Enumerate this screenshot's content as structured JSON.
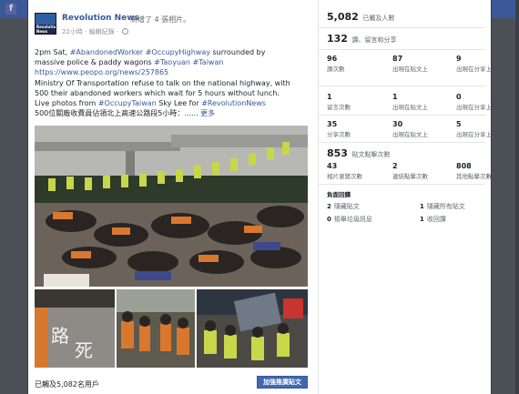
{
  "app": {
    "logo_letter": "f"
  },
  "post": {
    "page_name": "Revolution News",
    "action": "新增了 4 張相片。",
    "time": "22小時",
    "edit_label": "編輯紀錄",
    "avatar_text": "Revolution News",
    "text_lines": [
      [
        {
          "t": "2pm Sat, "
        },
        {
          "t": "#AbandonedWorker",
          "link": true
        },
        {
          "t": " "
        },
        {
          "t": "#OccupyHighway",
          "link": true
        },
        {
          "t": " surrounded by"
        }
      ],
      [
        {
          "t": "massive police & paddy wagons "
        },
        {
          "t": "#Taoyuan",
          "link": true
        },
        {
          "t": " "
        },
        {
          "t": "#Taiwan",
          "link": true
        }
      ],
      [
        {
          "t": "https://www.peopo.org/news/257865",
          "link": true
        }
      ],
      [
        {
          "t": "Ministry Of Transportation refuse to talk on the national highway, with"
        }
      ],
      [
        {
          "t": "500 their abandoned workers which wait for 5 hours without lunch."
        }
      ],
      [
        {
          "t": "Live photos from "
        },
        {
          "t": "#OccupyTaiwan",
          "link": true
        },
        {
          "t": " Sky Lee for "
        },
        {
          "t": "#RevolutionNews",
          "link": true
        }
      ],
      [
        {
          "t": "500位關廠收費員佔領北上高速公路段5小時：...... "
        },
        {
          "t": "更多",
          "link": true
        }
      ]
    ],
    "reach_text": "已觸及5,082名用戶",
    "boost_label": "加強推廣貼文"
  },
  "insights": {
    "reach": {
      "value": "5,082",
      "label": "已觸及人數"
    },
    "engagement": {
      "value": "132",
      "label": "讚、留言和分享"
    },
    "rows": [
      [
        {
          "value": "96",
          "label": "讚次數"
        },
        {
          "value": "87",
          "label": "出現在貼文上"
        },
        {
          "value": "9",
          "label": "出現在分享上"
        }
      ],
      [
        {
          "value": "1",
          "label": "留言次數"
        },
        {
          "value": "1",
          "label": "出現在貼文上"
        },
        {
          "value": "0",
          "label": "出現在分享上"
        }
      ],
      [
        {
          "value": "35",
          "label": "分享次數"
        },
        {
          "value": "30",
          "label": "出現在貼文上"
        },
        {
          "value": "5",
          "label": "出現在分享上"
        }
      ]
    ],
    "clicks": {
      "value": "853",
      "label": "貼文點擊次數"
    },
    "click_breakdown": [
      {
        "value": "43",
        "label": "相片瀏覽次數"
      },
      {
        "value": "2",
        "label": "連結點擊次數"
      },
      {
        "value": "808",
        "label": "其他點擊次數"
      }
    ],
    "negative_title": "負面回饋",
    "negative": [
      {
        "value": "2",
        "label": "隱藏貼文"
      },
      {
        "value": "1",
        "label": "隱藏所有貼文"
      },
      {
        "value": "0",
        "label": "檢舉垃圾訊息"
      },
      {
        "value": "1",
        "label": "收回讚"
      }
    ]
  }
}
